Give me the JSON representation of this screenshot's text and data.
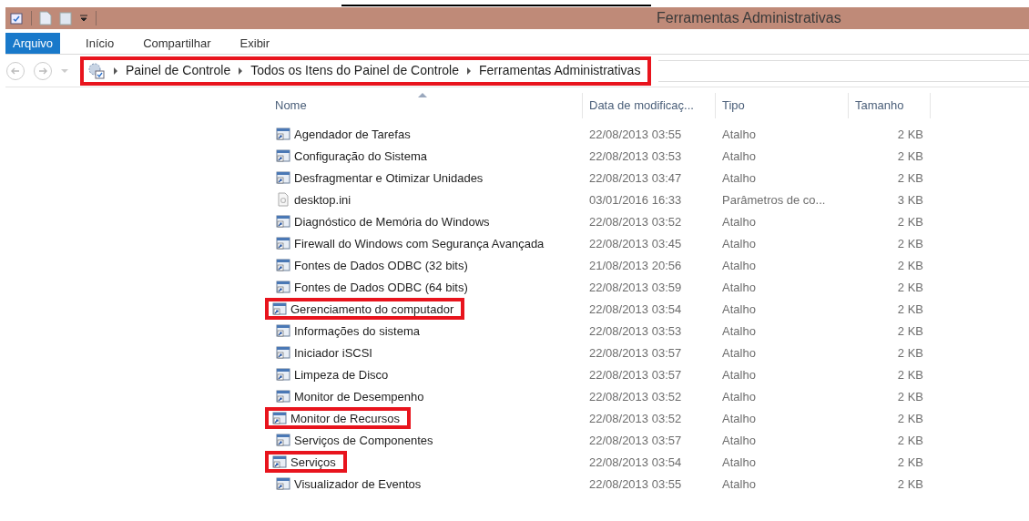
{
  "window": {
    "title": "Ferramentas Administrativas"
  },
  "ribbon_tabs": [
    {
      "label": "Arquivo",
      "selected": true
    },
    {
      "label": "Início",
      "selected": false
    },
    {
      "label": "Compartilhar",
      "selected": false
    },
    {
      "label": "Exibir",
      "selected": false
    }
  ],
  "address_bar": {
    "highlighted": true,
    "path": [
      "Painel de Controle",
      "Todos os Itens do Painel de Controle",
      "Ferramentas Administrativas"
    ]
  },
  "table": {
    "columns": [
      "Nome",
      "Data de modificaç...",
      "Tipo",
      "Tamanho"
    ],
    "rows": [
      {
        "name": "Agendador de Tarefas",
        "date": "22/08/2013 03:55",
        "type": "Atalho",
        "size": "2 KB",
        "highlighted": false,
        "kind": "shortcut"
      },
      {
        "name": "Configuração do Sistema",
        "date": "22/08/2013 03:53",
        "type": "Atalho",
        "size": "2 KB",
        "highlighted": false,
        "kind": "shortcut"
      },
      {
        "name": "Desfragmentar e Otimizar Unidades",
        "date": "22/08/2013 03:47",
        "type": "Atalho",
        "size": "2 KB",
        "highlighted": false,
        "kind": "shortcut"
      },
      {
        "name": "desktop.ini",
        "date": "03/01/2016 16:33",
        "type": "Parâmetros de co...",
        "size": "3 KB",
        "highlighted": false,
        "kind": "file"
      },
      {
        "name": "Diagnóstico de Memória do Windows",
        "date": "22/08/2013 03:52",
        "type": "Atalho",
        "size": "2 KB",
        "highlighted": false,
        "kind": "shortcut"
      },
      {
        "name": "Firewall do Windows com Segurança Avançada",
        "date": "22/08/2013 03:45",
        "type": "Atalho",
        "size": "2 KB",
        "highlighted": false,
        "kind": "shortcut"
      },
      {
        "name": "Fontes de Dados ODBC (32 bits)",
        "date": "21/08/2013 20:56",
        "type": "Atalho",
        "size": "2 KB",
        "highlighted": false,
        "kind": "shortcut"
      },
      {
        "name": "Fontes de Dados ODBC (64 bits)",
        "date": "22/08/2013 03:59",
        "type": "Atalho",
        "size": "2 KB",
        "highlighted": false,
        "kind": "shortcut"
      },
      {
        "name": "Gerenciamento do computador",
        "date": "22/08/2013 03:54",
        "type": "Atalho",
        "size": "2 KB",
        "highlighted": true,
        "kind": "shortcut"
      },
      {
        "name": "Informações do sistema",
        "date": "22/08/2013 03:53",
        "type": "Atalho",
        "size": "2 KB",
        "highlighted": false,
        "kind": "shortcut"
      },
      {
        "name": "Iniciador iSCSI",
        "date": "22/08/2013 03:57",
        "type": "Atalho",
        "size": "2 KB",
        "highlighted": false,
        "kind": "shortcut"
      },
      {
        "name": "Limpeza de Disco",
        "date": "22/08/2013 03:57",
        "type": "Atalho",
        "size": "2 KB",
        "highlighted": false,
        "kind": "shortcut"
      },
      {
        "name": "Monitor de Desempenho",
        "date": "22/08/2013 03:52",
        "type": "Atalho",
        "size": "2 KB",
        "highlighted": false,
        "kind": "shortcut"
      },
      {
        "name": "Monitor de Recursos",
        "date": "22/08/2013 03:52",
        "type": "Atalho",
        "size": "2 KB",
        "highlighted": true,
        "kind": "shortcut"
      },
      {
        "name": "Serviços de Componentes",
        "date": "22/08/2013 03:57",
        "type": "Atalho",
        "size": "2 KB",
        "highlighted": false,
        "kind": "shortcut"
      },
      {
        "name": "Serviços",
        "date": "22/08/2013 03:54",
        "type": "Atalho",
        "size": "2 KB",
        "highlighted": true,
        "kind": "shortcut"
      },
      {
        "name": "Visualizador de Eventos",
        "date": "22/08/2013 03:55",
        "type": "Atalho",
        "size": "2 KB",
        "highlighted": false,
        "kind": "shortcut"
      }
    ]
  }
}
